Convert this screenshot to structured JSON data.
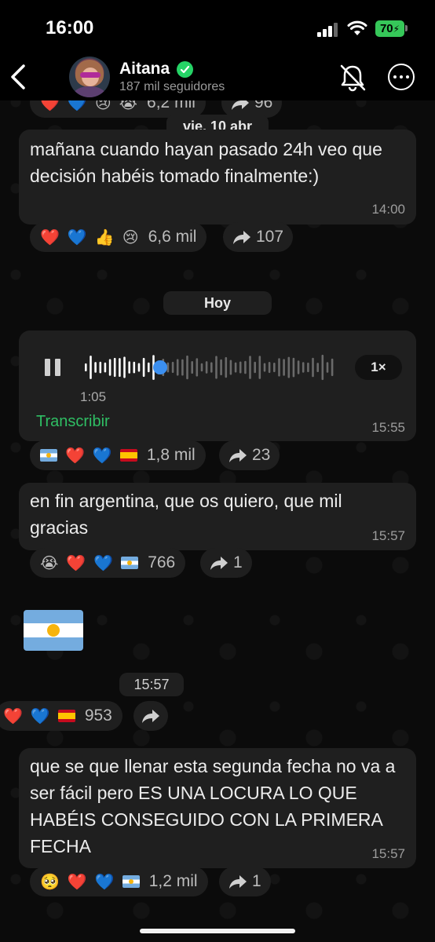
{
  "status_bar": {
    "time": "16:00",
    "battery": "70"
  },
  "header": {
    "channel_name": "Aitana",
    "followers": "187 mil seguidores"
  },
  "top_partial": {
    "reaction_count": "6,2 mil",
    "forward_count": "96"
  },
  "date_chips": {
    "first": "vie, 10 abr",
    "today": "Hoy"
  },
  "messages": [
    {
      "text": "mañana cuando hayan pasado 24h veo que decisión habéis tomado finalmente:)",
      "time": "14:00",
      "reactions": [
        "❤️",
        "💙",
        "👍",
        "😢"
      ],
      "reaction_count": "6,6 mil",
      "forward_count": "107"
    },
    {
      "type": "voice",
      "duration": "1:05",
      "speed": "1×",
      "transcribe_label": "Transcribir",
      "progress": 0.3,
      "time": "15:55",
      "reactions": [
        "🇦🇷",
        "❤️",
        "💙",
        "🇪🇸"
      ],
      "reaction_count": "1,8 mil",
      "forward_count": "23"
    },
    {
      "text": "en fin argentina, que os quiero, que mil gracias",
      "time": "15:57",
      "reactions": [
        "😭",
        "❤️",
        "💙",
        "🇦🇷"
      ],
      "reaction_count": "766",
      "forward_count": "1"
    },
    {
      "type": "sticker",
      "emoji": "🇦🇷",
      "time": "15:57",
      "reactions": [
        "❤️",
        "💙",
        "🇪🇸"
      ],
      "reaction_count": "953"
    },
    {
      "text": "que se que llenar esta segunda fecha no va a ser fácil pero ES UNA LOCURA LO QUE HABÉIS CONSEGUIDO CON LA PRIMERA FECHA",
      "time": "15:57",
      "reactions": [
        "🥺",
        "❤️",
        "💙",
        "🇦🇷"
      ],
      "reaction_count": "1,2 mil",
      "forward_count": "1"
    }
  ],
  "colors": {
    "accent_green": "#25d366",
    "bubble": "#1f1f1f",
    "transcribe": "#2fbf64"
  }
}
